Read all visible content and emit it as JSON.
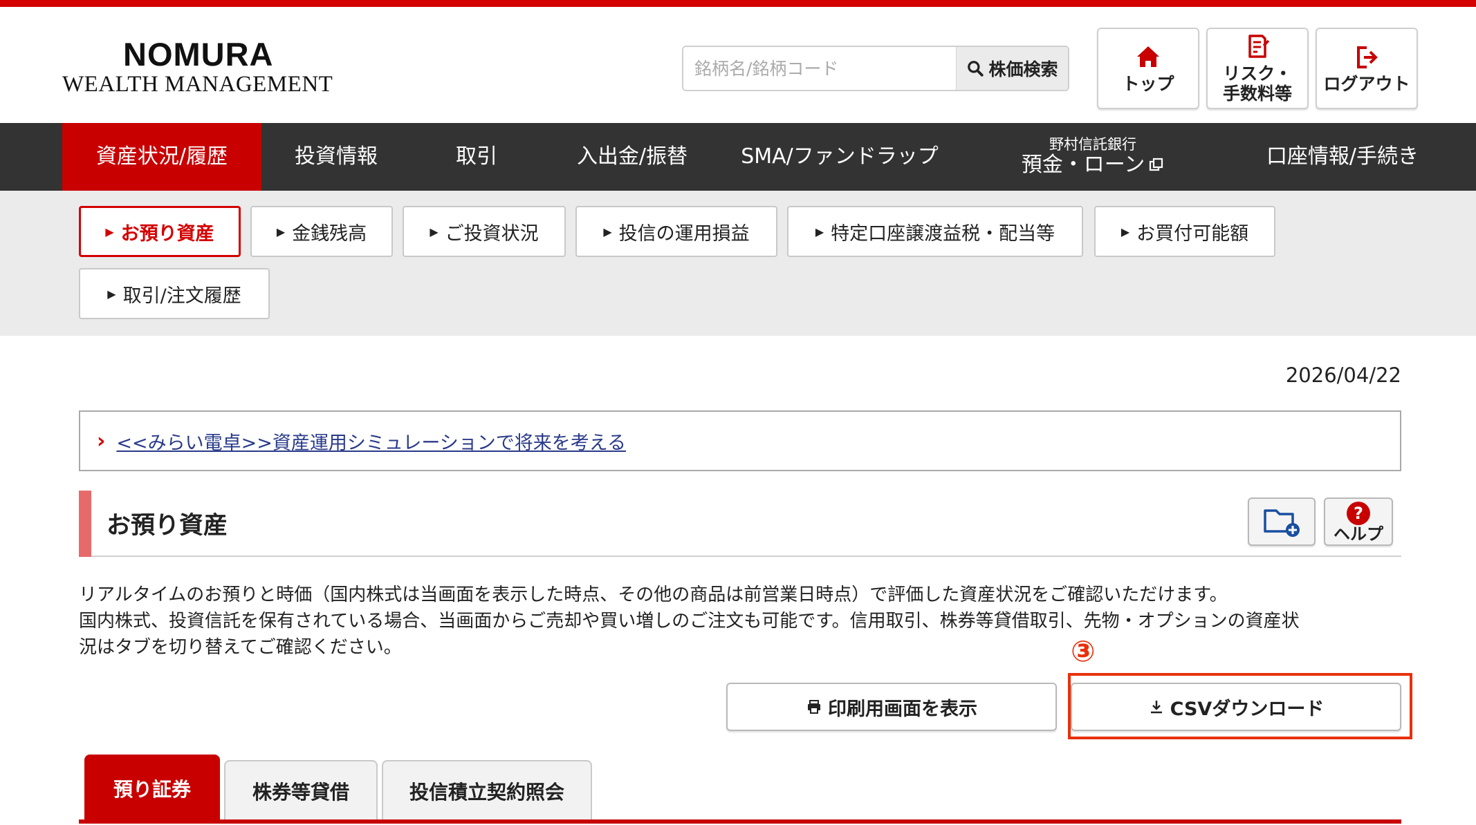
{
  "brand": {
    "logo_main": "NOMURA",
    "logo_sub": "WEALTH MANAGEMENT",
    "accent_color": "#d40000"
  },
  "search": {
    "placeholder": "銘柄名/銘柄コード",
    "button_label": "株価検索"
  },
  "header_buttons": [
    {
      "label": "トップ",
      "icon": "home-icon"
    },
    {
      "label": "リスク・\n手数料等",
      "icon": "document-icon"
    },
    {
      "label": "ログアウト",
      "icon": "logout-icon"
    }
  ],
  "main_nav": [
    {
      "label": "資産状況/履歴",
      "active": true
    },
    {
      "label": "投資情報"
    },
    {
      "label": "取引"
    },
    {
      "label": "入出金/振替"
    },
    {
      "label": "SMA/ファンドラップ"
    },
    {
      "label": "預金・ローン",
      "sublabel": "野村信託銀行",
      "icon": "external-link-icon"
    },
    {
      "label": "口座情報/手続き"
    }
  ],
  "sub_nav": [
    {
      "label": "お預り資産",
      "active": true
    },
    {
      "label": "金銭残高"
    },
    {
      "label": "ご投資状況"
    },
    {
      "label": "投信の運用損益"
    },
    {
      "label": "特定口座譲渡益税・配当等"
    },
    {
      "label": "お買付可能額"
    },
    {
      "label": "取引/注文履歴"
    }
  ],
  "date": "2026/04/22",
  "promo_link": "<<みらい電卓>>資産運用シミュレーションで将来を考える",
  "section": {
    "title": "お預り資産",
    "help_label": "ヘルプ"
  },
  "description": {
    "line1": "リアルタイムのお預りと時価（国内株式は当画面を表示した時点、その他の商品は前営業日時点）で評価した資産状況をご確認いただけます。",
    "line2": "国内株式、投資信託を保有されている場合、当画面からご売却や買い増しのご注文も可能です。信用取引、株券等貸借取引、先物・オプションの資産状",
    "line3": "況はタブを切り替えてご確認ください。"
  },
  "annotation": {
    "number": "③",
    "color": "#e8300c"
  },
  "actions": {
    "print_label": "印刷用画面を表示",
    "csv_label": "CSVダウンロード"
  },
  "portfolio_tabs": [
    {
      "label": "預り証券",
      "active": true
    },
    {
      "label": "株券等貸借"
    },
    {
      "label": "投信積立契約照会"
    }
  ]
}
